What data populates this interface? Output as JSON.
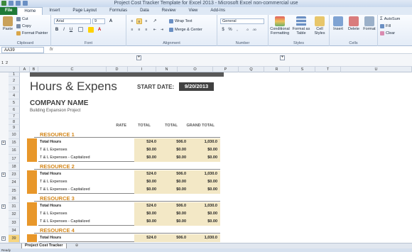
{
  "window": {
    "title": "Project Cost Tracker Template for Excel 2013 - Microsoft Excel non-commercial use"
  },
  "tabs": [
    "File",
    "Home",
    "Insert",
    "Page Layout",
    "Formulas",
    "Data",
    "Review",
    "View",
    "Add-Ins"
  ],
  "ribbon": {
    "clipboard": {
      "paste": "Paste",
      "cut": "Cut",
      "copy": "Copy",
      "format_painter": "Format Painter",
      "label": "Clipboard"
    },
    "font": {
      "name": "Arial",
      "size": "9",
      "bold": "B",
      "italic": "I",
      "underline": "U",
      "grow": "A",
      "label": "Font"
    },
    "alignment": {
      "wrap": "Wrap Text",
      "merge": "Merge & Center",
      "label": "Alignment"
    },
    "number": {
      "format": "General",
      "currency": "$",
      "percent": "%",
      "comma": ",",
      "label": "Number"
    },
    "styles": {
      "conditional": "Conditional Formatting",
      "format_table": "Format as Table",
      "cell_styles": "Cell Styles",
      "label": "Styles"
    },
    "cells": {
      "insert": "Insert",
      "delete": "Delete",
      "format": "Format",
      "label": "Cells"
    },
    "editing": {
      "autosum": "AutoSum",
      "fill": "Fill",
      "clear": "Clear",
      "label": "Editing"
    }
  },
  "formula_bar": {
    "name_box": "AA39",
    "fx": "fx",
    "content": ""
  },
  "outline": {
    "levels": [
      "1",
      "2"
    ]
  },
  "columns": [
    "A",
    "B",
    "C",
    "D",
    "I",
    "N",
    "O",
    "P",
    "Q",
    "R",
    "S",
    "T",
    "U"
  ],
  "rows": [
    "1",
    "2",
    "3",
    "4",
    "5",
    "6",
    "7",
    "8",
    "9",
    "10",
    "15",
    "16",
    "17",
    "18",
    "23",
    "24",
    "25",
    "26",
    "31",
    "32",
    "33",
    "34",
    "39"
  ],
  "selected_row": "39",
  "sheet": {
    "title": "Hours & Expens",
    "start_date_label": "START DATE:",
    "start_date": "9/20/2013",
    "company": "COMPANY NAME",
    "project": "Building Expansion Project",
    "col_rate": "RATE",
    "col_total1": "TOTAL",
    "col_total2": "TOTAL",
    "col_grand": "GRAND TOTAL",
    "resources": [
      {
        "name": "RESOURCE 1",
        "rows": [
          {
            "label": "Total Hours",
            "v1": "524.0",
            "v2": "506.0",
            "v3": "1,030.0"
          },
          {
            "label": "T & L Expenses",
            "v1": "$0.00",
            "v2": "$0.00",
            "v3": "$0.00"
          },
          {
            "label": "T & L Expenses - Capitalized",
            "v1": "$0.00",
            "v2": "$0.00",
            "v3": "$0.00"
          }
        ]
      },
      {
        "name": "RESOURCE 2",
        "rows": [
          {
            "label": "Total Hours",
            "v1": "524.0",
            "v2": "506.0",
            "v3": "1,030.0"
          },
          {
            "label": "T & L Expenses",
            "v1": "$0.00",
            "v2": "$0.00",
            "v3": "$0.00"
          },
          {
            "label": "T & L Expenses - Capitalized",
            "v1": "$0.00",
            "v2": "$0.00",
            "v3": "$0.00"
          }
        ]
      },
      {
        "name": "RESOURCE 3",
        "rows": [
          {
            "label": "Total Hours",
            "v1": "524.0",
            "v2": "506.0",
            "v3": "1,030.0"
          },
          {
            "label": "T & L Expenses",
            "v1": "$0.00",
            "v2": "$0.00",
            "v3": "$0.00"
          },
          {
            "label": "T & L Expenses - Capitalized",
            "v1": "$0.00",
            "v2": "$0.00",
            "v3": "$0.00"
          }
        ]
      },
      {
        "name": "RESOURCE 4",
        "rows": [
          {
            "label": "Total Hours",
            "v1": "524.0",
            "v2": "506.0",
            "v3": "1,030.0"
          }
        ]
      }
    ]
  },
  "sheet_tabs": [
    "Project Cost Tracker"
  ],
  "status": "Ready",
  "colors": {
    "accent": "#1f7a36",
    "resource_title": "#d4871a",
    "stripe": "#e8972a",
    "shade": "#f3e8c6",
    "dark": "#404040"
  }
}
